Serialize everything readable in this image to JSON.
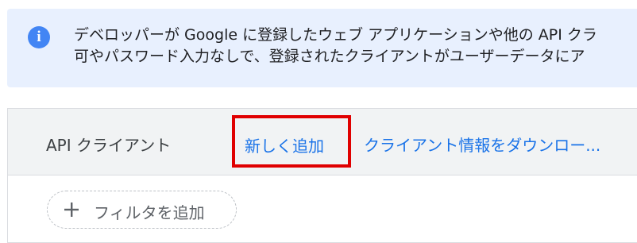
{
  "info_banner": {
    "icon": "info-icon",
    "line1": "デベロッパーが Google に登録したウェブ アプリケーションや他の API クラ",
    "line2": "可やパスワード入力なしで、登録されたクライアントがユーザーデータにア"
  },
  "clients_panel": {
    "title": "API クライアント",
    "add_new_label": "新しく追加",
    "download_label": "クライアント情報をダウンロー..."
  },
  "filter": {
    "icon": "plus-icon",
    "label": "フィルタを追加"
  },
  "colors": {
    "banner_bg": "#e8f0fe",
    "info_icon": "#4285f4",
    "link": "#1a73e8",
    "highlight_box": "#e00000",
    "header_bg": "#f1f3f4"
  }
}
